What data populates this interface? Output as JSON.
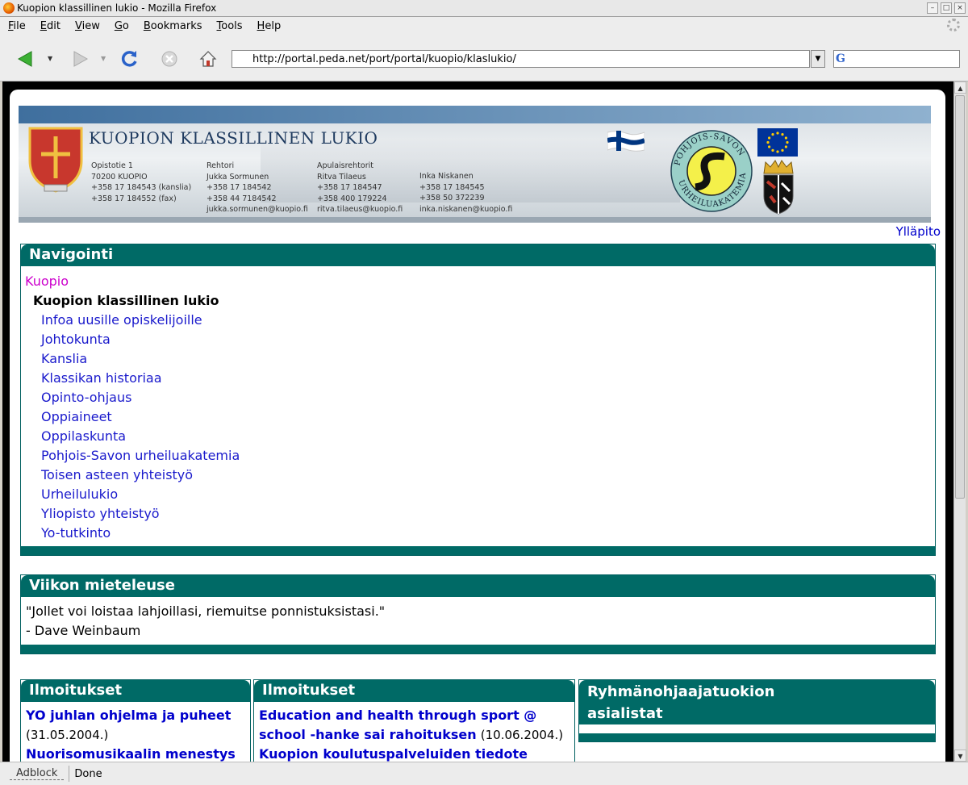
{
  "window": {
    "title": "Kuopion klassillinen lukio - Mozilla Firefox"
  },
  "menu": [
    "File",
    "Edit",
    "View",
    "Go",
    "Bookmarks",
    "Tools",
    "Help"
  ],
  "address": {
    "url": "http://portal.peda.net/port/portal/kuopio/klaslukio/"
  },
  "search": {
    "engine_glyph": "G"
  },
  "status": {
    "adblock": "Adblock",
    "text": "Done"
  },
  "banner": {
    "school_name": "KUOPION KLASSILLINEN LUKIO",
    "address": [
      "Opistotie 1",
      "70200 KUOPIO",
      "+358 17 184543 (kanslia)",
      "+358 17 184552 (fax)"
    ],
    "rehtori": [
      "Rehtori",
      "Jukka Sormunen",
      "+358 17 184542",
      "+358 44 7184542",
      "jukka.sormunen@kuopio.fi"
    ],
    "apulais1": [
      "Apulaisrehtorit",
      "Ritva Tilaeus",
      "+358 17 184547",
      "+358 400 179224",
      "ritva.tilaeus@kuopio.fi"
    ],
    "apulais2": [
      "Inka Niskanen",
      "+358 17 184545",
      "+358 50 372239",
      "inka.niskanen@kuopio.fi"
    ],
    "uas_top": "POHJOIS-SAVON",
    "uas_bottom": "URHEILUAKATEMIA"
  },
  "yllapito": "Ylläpito",
  "navigation": {
    "title": "Navigointi",
    "root": "Kuopio",
    "current": "Kuopion klassillinen lukio",
    "items": [
      "Infoa uusille opiskelijoille",
      "Johtokunta",
      "Kanslia",
      "Klassikan historiaa",
      "Opinto-ohjaus",
      "Oppiaineet",
      "Oppilaskunta",
      "Pohjois-Savon urheiluakatemia",
      "Toisen asteen yhteistyö",
      "Urheilulukio",
      "Yliopisto yhteistyö",
      "Yo-tutkinto"
    ]
  },
  "quote": {
    "title": "Viikon mieteleuse",
    "text": "\"Jollet voi loistaa lahjoillasi, riemuitse ponnistuksistasi.\"",
    "author": "- Dave Weinbaum"
  },
  "announcements": [
    {
      "title": "Ilmoitukset",
      "items": [
        {
          "link": "YO juhlan ohjelma ja puheet",
          "date": "(31.05.2004.)"
        },
        {
          "link": "Nuorisomusikaalin menestys",
          "date": ""
        }
      ]
    },
    {
      "title": "Ilmoitukset",
      "items": [
        {
          "link": "Education and health through sport @ school -hanke sai rahoituksen",
          "date": "(10.06.2004.)"
        },
        {
          "link": "Kuopion koulutuspalveluiden tiedote",
          "date": ""
        }
      ]
    }
  ],
  "agenda": {
    "title": "Ryhmänohjaajatuokion asialistat"
  }
}
